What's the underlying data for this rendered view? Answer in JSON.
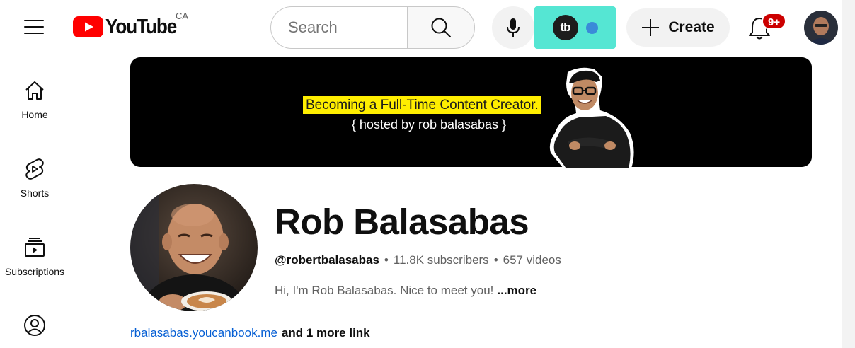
{
  "header": {
    "logo_text": "YouTube",
    "country_code": "CA",
    "search_placeholder": "Search",
    "create_label": "Create",
    "notification_badge": "9+",
    "extension_name": "tb"
  },
  "sidebar": {
    "items": [
      {
        "label": "Home",
        "icon": "home-icon"
      },
      {
        "label": "Shorts",
        "icon": "shorts-icon"
      },
      {
        "label": "Subscriptions",
        "icon": "subscriptions-icon"
      },
      {
        "label": "",
        "icon": "you-icon"
      }
    ]
  },
  "banner": {
    "title": "Becoming a Full-Time Content Creator.",
    "subtitle": "{ hosted by rob balasabas }",
    "highlight_color": "#ffee00"
  },
  "channel": {
    "name": "Rob Balasabas",
    "handle": "@robertbalasabas",
    "separator": "•",
    "subscribers": "11.8K subscribers",
    "videos": "657 videos",
    "description": "Hi, I'm Rob Balasabas. Nice to meet you!",
    "more_label": "...more",
    "link_text": "rbalasabas.youcanbook.me",
    "more_links": "and 1 more link"
  },
  "colors": {
    "brand_red": "#ff0000",
    "extension_bg": "#55e6d3",
    "link_blue": "#065fd4",
    "badge_red": "#cc0000"
  }
}
